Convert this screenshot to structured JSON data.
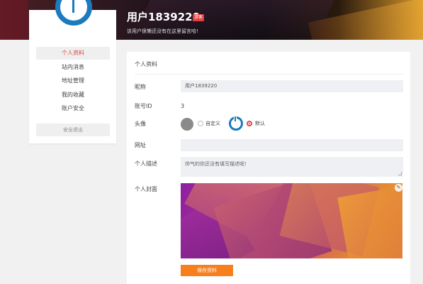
{
  "header": {
    "username": "用户1839220",
    "badge": "游客",
    "signature": "该用户很懒还没有在这里留言哈!"
  },
  "sidebar": {
    "items": [
      {
        "label": "个人资料",
        "active": true
      },
      {
        "label": "站内消息",
        "active": false
      },
      {
        "label": "地址管理",
        "active": false
      },
      {
        "label": "我的收藏",
        "active": false
      },
      {
        "label": "账户安全",
        "active": false
      }
    ],
    "logout_label": "安全退出"
  },
  "profile": {
    "title": "个人资料",
    "labels": {
      "nickname": "昵称",
      "account_id": "账号ID",
      "avatar": "头像",
      "website": "网址",
      "description": "个人描述",
      "cover": "个人封面"
    },
    "nickname_value": "用户1839220",
    "account_id_value": "3",
    "avatar_options": {
      "custom_label": "自定义",
      "default_label": "默认",
      "selected": "默认"
    },
    "website_value": "",
    "description_placeholder": "帅气的你还没有填写描述呢!",
    "save_label": "保存资料"
  },
  "colors": {
    "accent_red": "#e0464b",
    "brand_blue": "#1b7bbd",
    "save_orange": "#f77f1e"
  }
}
